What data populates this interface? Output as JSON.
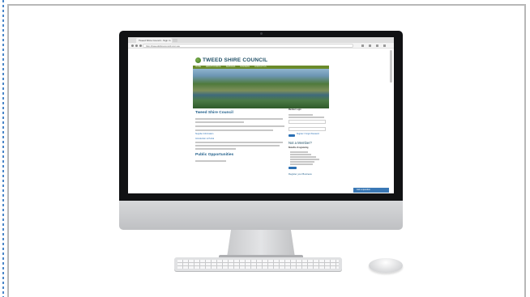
{
  "browser": {
    "tab_title": "Tweed Shire Council - Sign In",
    "address": "http://tweedshirecouncil.com.au"
  },
  "site": {
    "logo_text": "TWEED SHIRE COUNCIL",
    "nav": [
      "HOME",
      "ABOUT COUNCIL",
      "SERVICES",
      "BUSINESS",
      "CONTACT US"
    ],
    "main": {
      "heading": "Tweed Shire Council",
      "link1": "Supplier Information",
      "link2": "Introduction to Portal",
      "subheading": "Public Opportunities"
    },
    "sidebar": {
      "heading": "Member Login",
      "login_link": "Register / Forgot Password",
      "not_member": "Not a Member?",
      "register_heading": "Benefits of registering",
      "register_link": "Register your Business"
    },
    "chat_button": "Ask a question"
  },
  "colors": {
    "nav_green": "#6a8a2a",
    "heading_blue": "#1f5e8a",
    "button_blue": "#2a6fb4"
  }
}
